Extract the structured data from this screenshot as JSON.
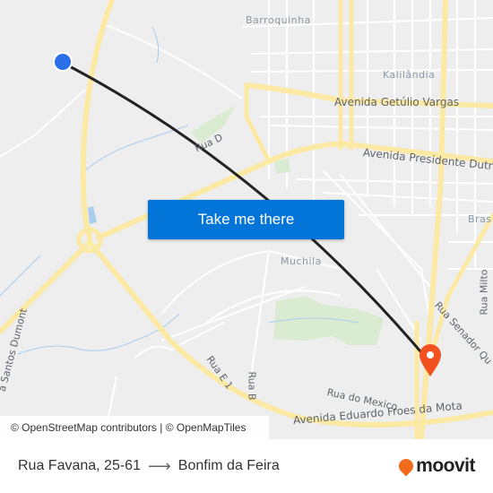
{
  "map": {
    "labels": {
      "barroquinha": "Barroquinha",
      "kalilandia": "Kalilândia",
      "getulio": "Avenida Getúlio Vargas",
      "dutra": "Avenida Presidente Dutra",
      "ruad": "Rua D",
      "muchila": "Muchila",
      "bras": "Bras",
      "senador": "Rua Senador Qu",
      "milton": "Rua Milto",
      "santos": "a Santos Dumont",
      "ruae1": "Rua E 1",
      "ruab": "Rua B",
      "mexico": "Rua do Mexico",
      "froes": "Avenida Eduardo Froes da Mota"
    },
    "colors": {
      "origin": "#2b6fe8",
      "destination": "#f0511f",
      "route_line": "#222222",
      "major_road": "#fbe9a4",
      "park": "#d9ecd2",
      "water": "#a8cdee"
    },
    "origin_icon": "origin-dot-icon",
    "destination_icon": "destination-pin-icon"
  },
  "cta": {
    "label": "Take me there"
  },
  "attribution": "© OpenStreetMap contributors | © OpenMapTiles",
  "footer": {
    "origin": "Rua Favana, 25-61",
    "arrow": "⟶",
    "destination": "Bonfim da Feira",
    "brand": "moovit"
  }
}
